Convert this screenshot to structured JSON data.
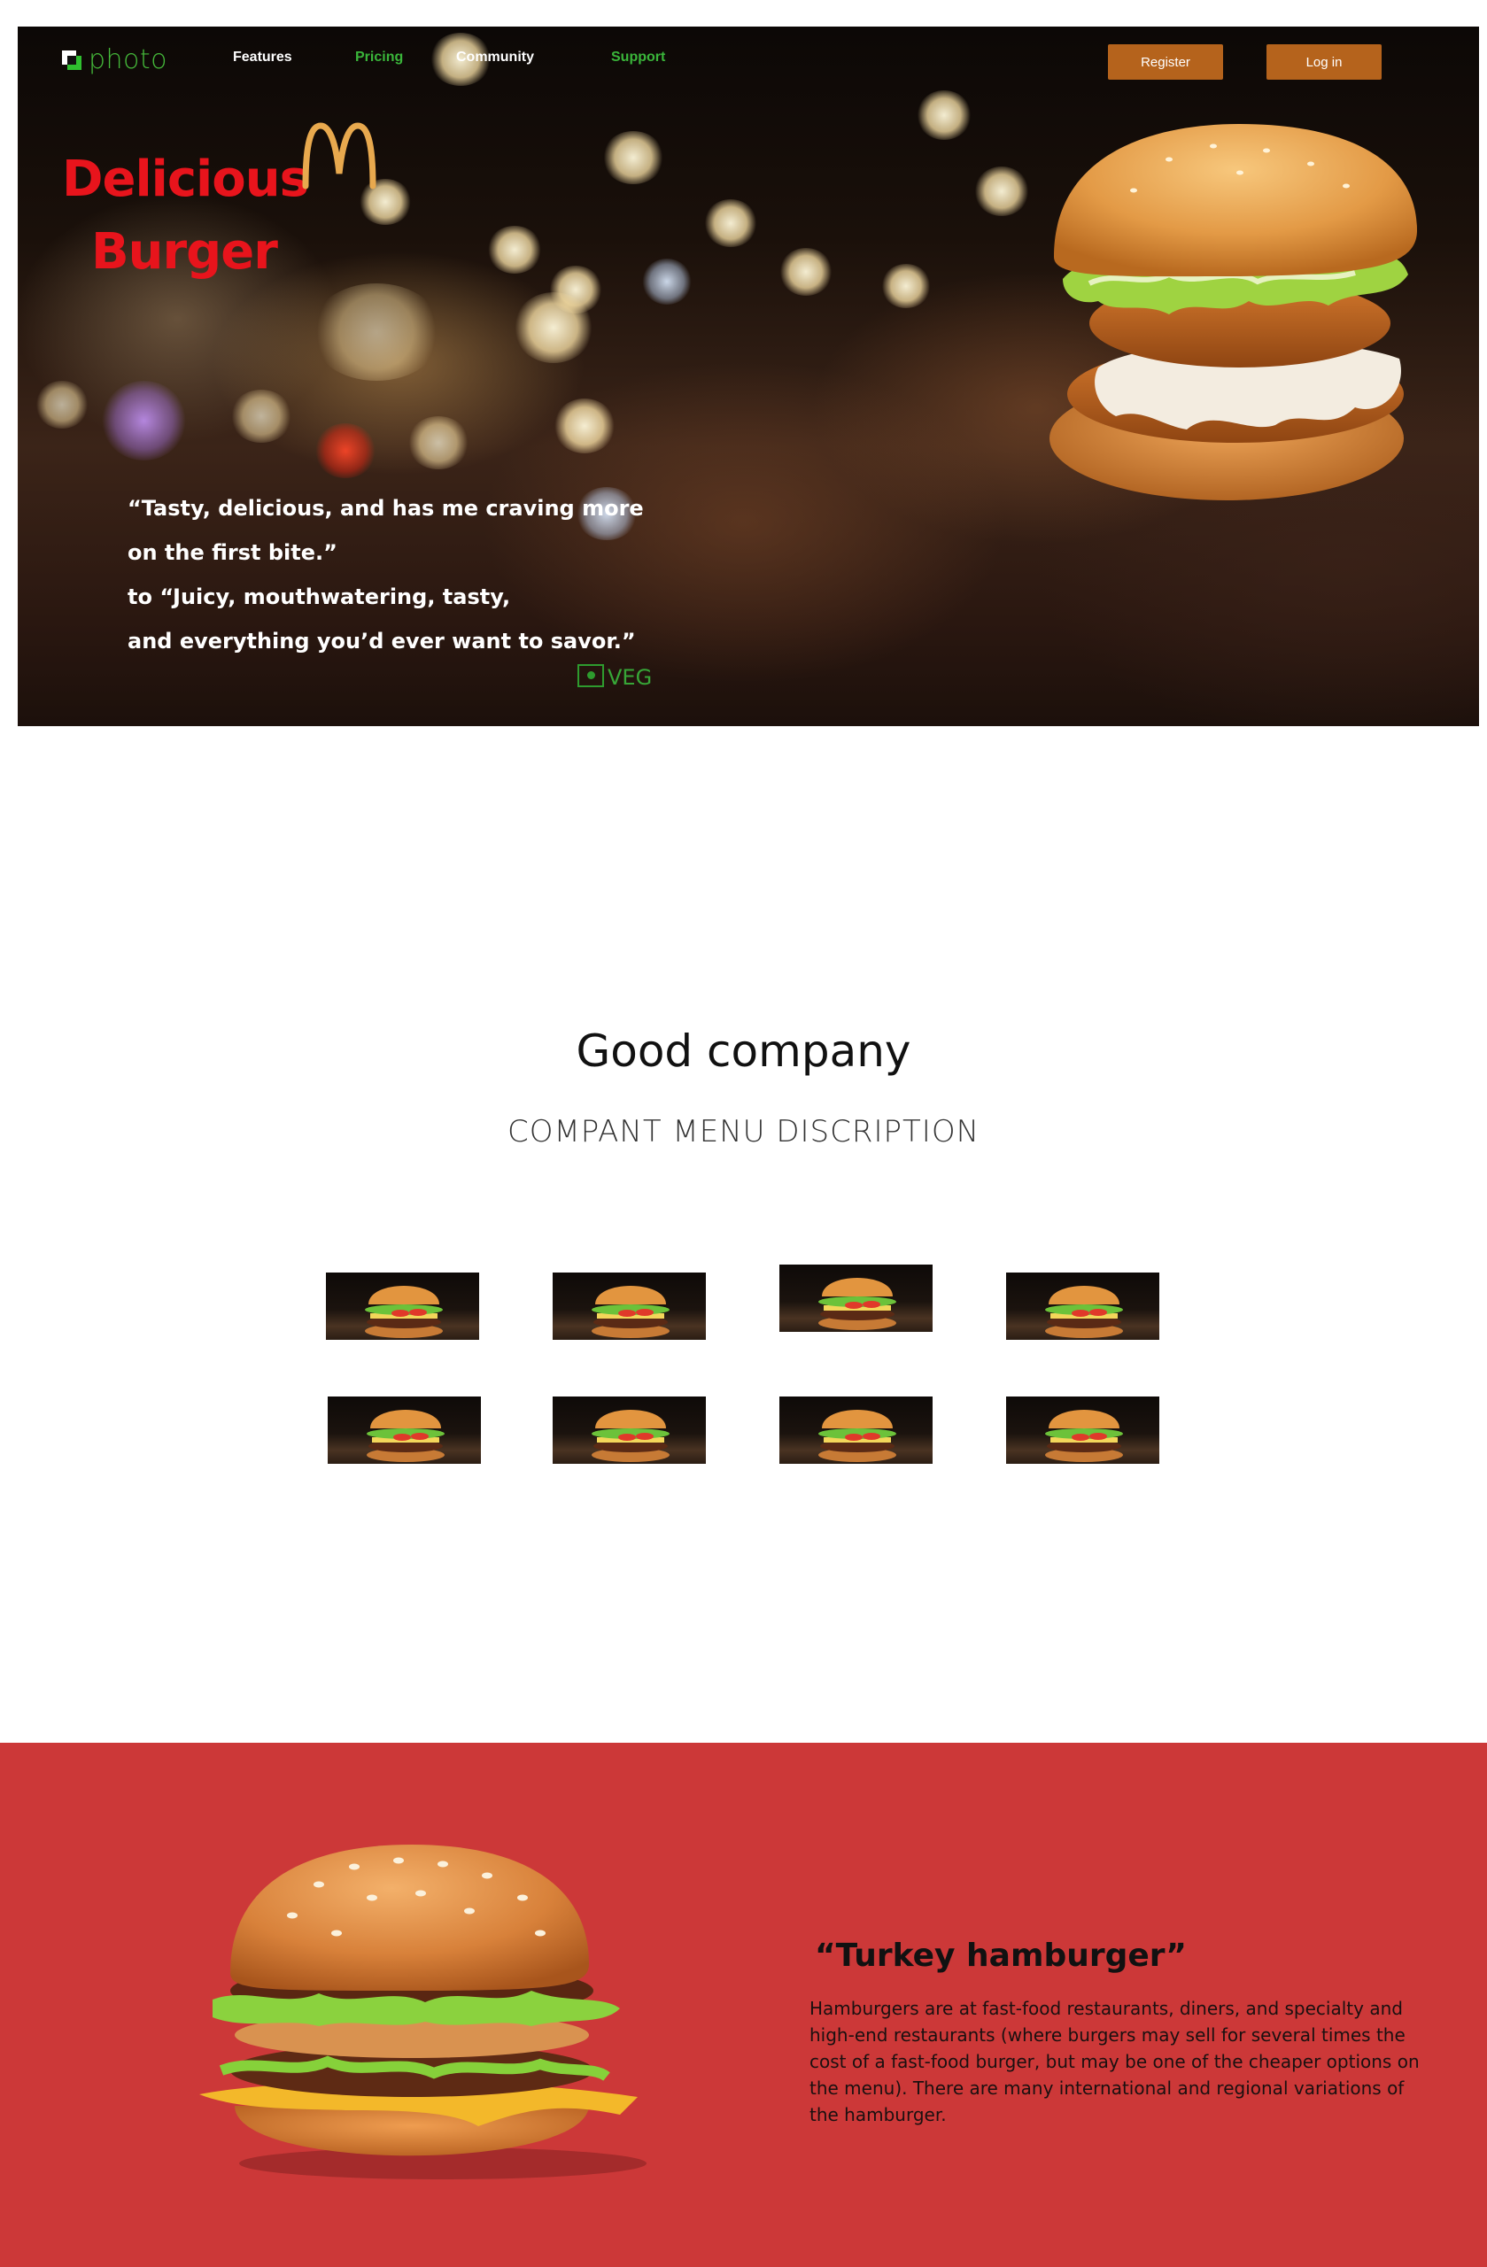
{
  "nav": {
    "logo": "photo",
    "links": [
      {
        "label": "Features",
        "color": "#ffffff"
      },
      {
        "label": "Pricing",
        "color": "#3ab53a"
      },
      {
        "label": "Community",
        "color": "#ffffff"
      },
      {
        "label": "Support",
        "color": "#3ab53a"
      }
    ],
    "register_label": "Register",
    "login_label": "Log in"
  },
  "hero": {
    "title_line1": "Delicious",
    "title_line2": "Burger",
    "quote_lines": [
      "“Tasty, delicious, and has me craving more",
      "on the first bite.”",
      " to “Juicy, mouthwatering, tasty,",
      " and everything you’d ever want to savor.”"
    ],
    "veg_label": "VEG"
  },
  "company": {
    "title": "Good company",
    "subtitle": "COMPANT MENU DISCRIPTION"
  },
  "product": {
    "title": "“Turkey hamburger”",
    "description": "Hamburgers are   at fast-food restaurants, diners, and specialty and high-end restaurants (where burgers may sell for several times the cost of a fast-food burger, but may be one of the cheaper options on the menu). There are many international and regional variations of the hamburger."
  },
  "colors": {
    "brand_green": "#45b93a",
    "title_red": "#e8141c",
    "button_brown": "#b5631c",
    "section_red": "#cc3838"
  }
}
